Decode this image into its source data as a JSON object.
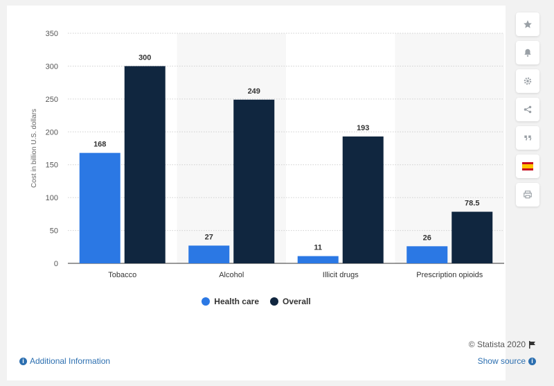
{
  "chart_data": {
    "type": "bar",
    "categories": [
      "Tobacco",
      "Alcohol",
      "Illicit drugs",
      "Prescription opioids"
    ],
    "series": [
      {
        "name": "Health care",
        "values": [
          168,
          27,
          11,
          26
        ],
        "labels": [
          "168",
          "27",
          "11",
          "26"
        ],
        "color": "#2b78e4"
      },
      {
        "name": "Overall",
        "values": [
          300,
          249,
          193,
          78.5
        ],
        "labels": [
          "300",
          "249",
          "193",
          "78.5"
        ],
        "color": "#10263f"
      }
    ],
    "ylabel": "Cost in billion U.S. dollars",
    "ylim": [
      0,
      350
    ],
    "yticks": [
      0,
      50,
      100,
      150,
      200,
      250,
      300,
      350
    ],
    "grid": true,
    "legend_position": "bottom"
  },
  "credit": "© Statista 2020",
  "footer": {
    "additional_info": "Additional Information",
    "show_source": "Show source"
  },
  "sidebar": {
    "icons": [
      "star-icon",
      "bell-icon",
      "gear-icon",
      "share-icon",
      "quote-icon",
      "flag-icon",
      "print-icon"
    ]
  },
  "colors": {
    "accent": "#2c6fb0",
    "band": "#f7f7f7"
  }
}
